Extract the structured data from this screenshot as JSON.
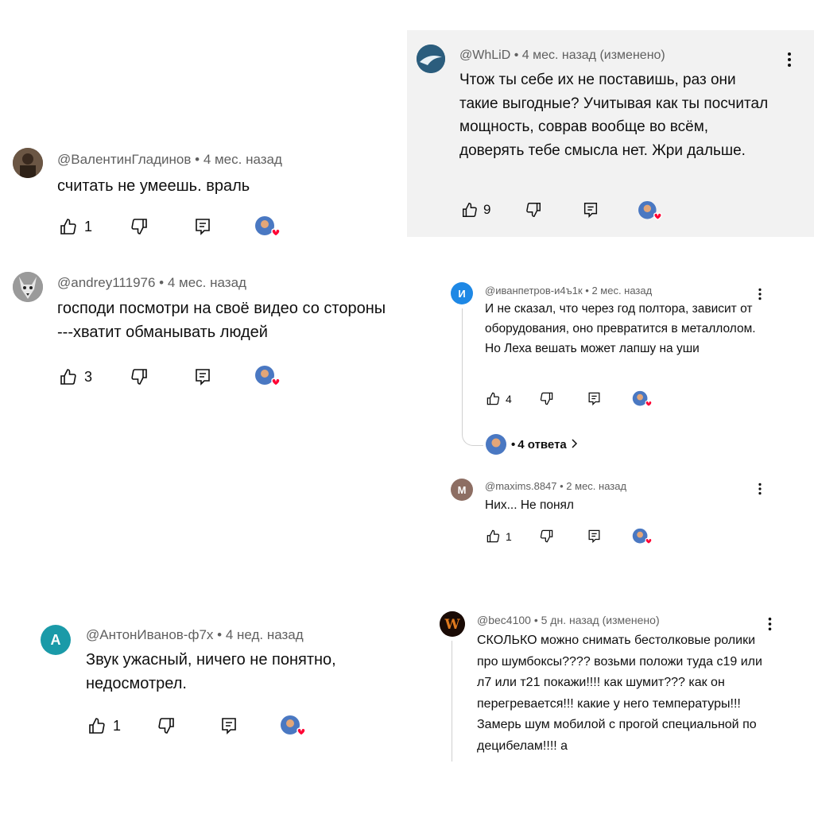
{
  "comments": [
    {
      "user": "@ВалентинГладинов",
      "time": "4 мес. назад",
      "text": "считать не умеешь. враль",
      "likes": "1"
    },
    {
      "user": "@andrey111976",
      "time": "4 мес. назад",
      "text": "господи посмотри на своё видео со стороны ---хватит обманывать людей",
      "likes": "3"
    },
    {
      "user": "@АнтонИванов-ф7х",
      "time": "4 нед. назад",
      "avatar_letter": "A",
      "text": "Звук ужасный, ничего не понятно, недосмотрел.",
      "likes": "1"
    },
    {
      "user": "@WhLiD",
      "time": "4 мес. назад (изменено)",
      "text": "Чтож ты себе их не поставишь, раз они такие выгодные? Учитывая как ты посчитал мощность, соврав вообще во всём, доверять тебе смысла нет. Жри дальше.",
      "likes": "9"
    },
    {
      "user": "@иванпетров-и4ъ1к",
      "time": "2 мес. назад",
      "avatar_letter": "И",
      "text": "И не сказал, что через год полтора, зависит от оборудования, оно превратится в металлолом. Но Леха вешать может лапшу на уши",
      "likes": "4",
      "replies_label": "4 ответа"
    },
    {
      "user": "@maxims.8847",
      "time": "2 мес. назад",
      "avatar_letter": "M",
      "text": "Них... Не понял",
      "likes": "1"
    },
    {
      "user": "@bec4100",
      "time": "5 дн. назад (изменено)",
      "text": "СКОЛЬКО можно снимать бестолковые ролики про шумбоксы???? возьми положи туда с19 или л7 или т21 покажи!!!! как шумит??? как он перегревается!!! какие у него температуры!!! Замерь шум мобилой с прогой специальной по децибелам!!!! а",
      "likes": ""
    }
  ],
  "separator": " • ",
  "icons": {
    "like": "thumb-up-icon",
    "dislike": "thumb-down-icon",
    "reply": "reply-icon",
    "heart": "creator-heart-icon",
    "more": "more-vert-icon"
  },
  "colors": {
    "heart": "#ff0033",
    "avatar_teal": "#1a9aa8",
    "avatar_blue": "#1e88e5",
    "avatar_brown": "#8d6e63"
  }
}
